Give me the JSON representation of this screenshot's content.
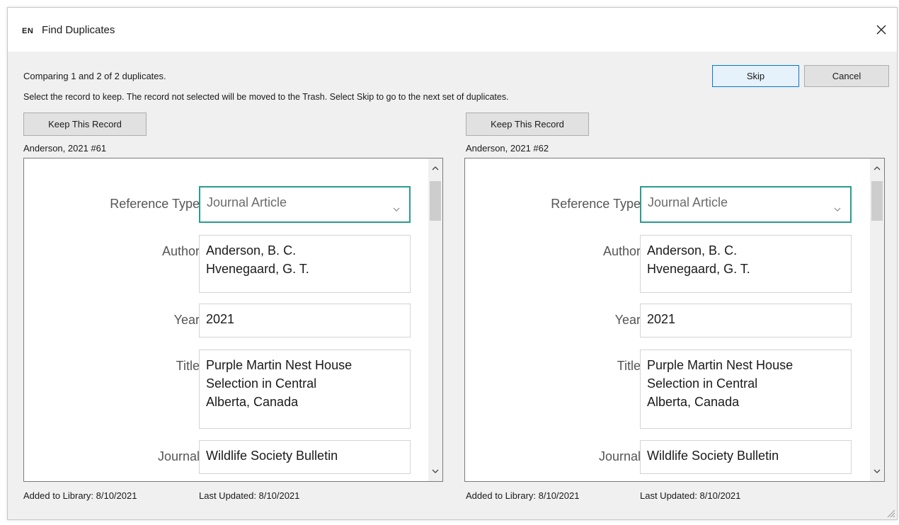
{
  "window": {
    "app_icon": "EN",
    "title": "Find Duplicates",
    "close_glyph": "✕"
  },
  "status": "Comparing 1 and 2 of 2 duplicates.",
  "instruction": "Select the record to keep. The record not selected will be moved to the Trash. Select Skip to go to the next set of duplicates.",
  "buttons": {
    "skip": "Skip",
    "cancel": "Cancel"
  },
  "records": [
    {
      "keep_label": "Keep This Record",
      "id": "Anderson, 2021 #61",
      "reference_type_label": "Reference Type",
      "reference_type_value": "Journal Article",
      "author_label": "Author",
      "authors": [
        "Anderson, B. C.",
        "Hvenegaard, G. T."
      ],
      "year_label": "Year",
      "year": "2021",
      "title_label": "Title",
      "title_lines": [
        "Purple Martin Nest House",
        "Selection in Central",
        "Alberta, Canada"
      ],
      "journal_label": "Journal",
      "journal": "Wildlife Society Bulletin",
      "added": "Added to Library: 8/10/2021",
      "updated": "Last Updated: 8/10/2021"
    },
    {
      "keep_label": "Keep This Record",
      "id": "Anderson, 2021 #62",
      "reference_type_label": "Reference Type",
      "reference_type_value": "Journal Article",
      "author_label": "Author",
      "authors": [
        "Anderson, B. C.",
        "Hvenegaard, G. T."
      ],
      "year_label": "Year",
      "year": "2021",
      "title_label": "Title",
      "title_lines": [
        "Purple Martin Nest House",
        "Selection in Central",
        "Alberta, Canada"
      ],
      "journal_label": "Journal",
      "journal": "Wildlife Society Bulletin",
      "added": "Added to Library: 8/10/2021",
      "updated": "Last Updated: 8/10/2021"
    }
  ],
  "colors": {
    "accent": "#2a9d8f",
    "skip_border": "#0078d7"
  }
}
